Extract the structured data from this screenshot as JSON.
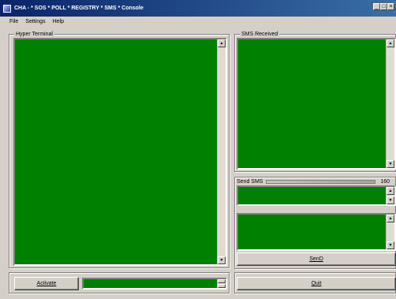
{
  "window": {
    "title": "CHA - * SOS * POLL * REGISTRY * SMS * Console",
    "min_glyph": "_",
    "max_glyph": "□",
    "close_glyph": "×"
  },
  "menu": [
    "File",
    "Settings",
    "Help"
  ],
  "hyper_terminal": {
    "label": "Hyper Terminal"
  },
  "sms_received": {
    "label": "SMS Received"
  },
  "send_sms": {
    "label": "Send SMS",
    "count": "160"
  },
  "buttons": {
    "send": "SenD",
    "quit": "Quit",
    "activate": "Activate"
  },
  "scroll_glyphs": {
    "up": "▲",
    "down": "▼"
  },
  "colors": {
    "terminal_bg": "#008000",
    "titlebar": "#0a246a"
  },
  "icons": {
    "app": "app-icon"
  }
}
